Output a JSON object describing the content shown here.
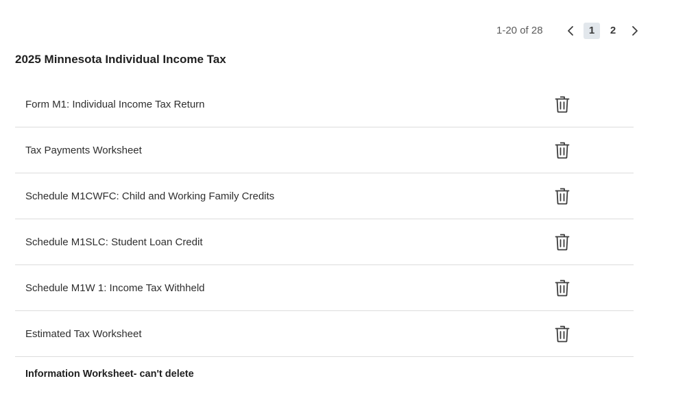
{
  "pagination": {
    "range": "1-20 of 28",
    "pages": [
      "1",
      "2"
    ],
    "active_page": "1",
    "prev_icon": "chevron-left-icon",
    "next_icon": "chevron-right-icon"
  },
  "section": {
    "title": "2025 Minnesota Individual Income Tax"
  },
  "forms": [
    {
      "name": "Form M1: Individual Income Tax Return",
      "delete_icon": "trash-icon"
    },
    {
      "name": "Tax Payments Worksheet",
      "delete_icon": "trash-icon"
    },
    {
      "name": "Schedule M1CWFC: Child and Working Family Credits",
      "delete_icon": "trash-icon"
    },
    {
      "name": "Schedule M1SLC: Student Loan Credit",
      "delete_icon": "trash-icon"
    },
    {
      "name": "Schedule M1W 1: Income Tax Withheld",
      "delete_icon": "trash-icon"
    },
    {
      "name": "Estimated Tax Worksheet",
      "delete_icon": "trash-icon"
    }
  ],
  "info_worksheet": {
    "name": "Information Worksheet- can't delete"
  },
  "colors": {
    "active_page_bg": "#e2e7ec",
    "divider": "#dcdcdc",
    "icon": "#3c3c3c"
  }
}
